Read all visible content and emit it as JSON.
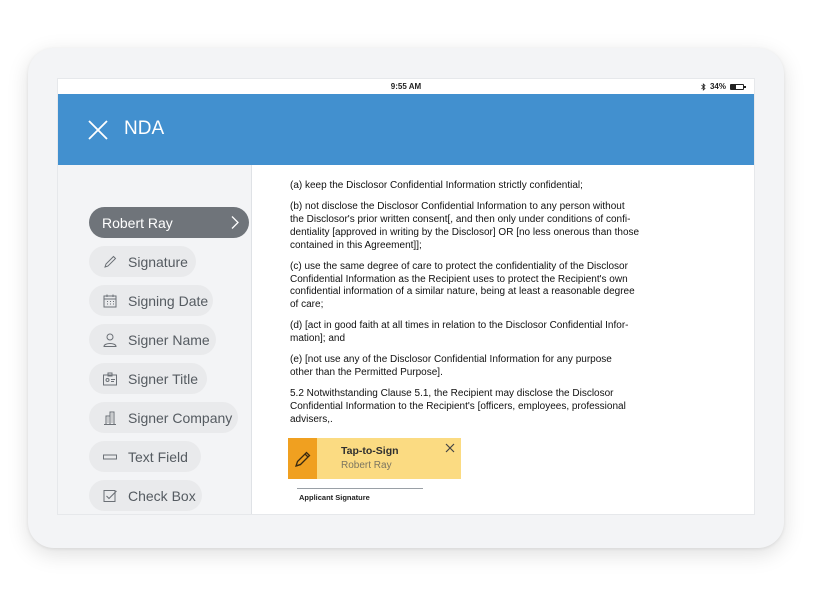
{
  "status_bar": {
    "time": "9:55 AM",
    "battery_percent": "34%",
    "icons": [
      "bluetooth-icon",
      "battery-icon"
    ]
  },
  "app_bar": {
    "title": "NDA",
    "close_icon": "close-icon"
  },
  "sidebar": {
    "signer": {
      "label": "Robert Ray",
      "icon": "chevron-right-icon"
    },
    "fields": [
      {
        "label": "Signature",
        "icon": "pencil-icon"
      },
      {
        "label": "Signing Date",
        "icon": "calendar-icon"
      },
      {
        "label": "Signer Name",
        "icon": "person-icon"
      },
      {
        "label": "Signer Title",
        "icon": "id-badge-icon"
      },
      {
        "label": "Signer Company",
        "icon": "building-icon"
      },
      {
        "label": "Text Field",
        "icon": "text-field-icon"
      },
      {
        "label": "Check Box",
        "icon": "checkbox-icon"
      }
    ]
  },
  "document": {
    "paragraphs": [
      {
        "lines": [
          "(a)  keep the Disclosor Confidential Information strictly confidential;"
        ]
      },
      {
        "lines": [
          "(b)  not disclose the Disclosor Confidential Information to any person without",
          "the Disclosor's prior written consent[, and then only under conditions of confi-",
          "dentiality [approved in writing by the Disclosor] OR [no less onerous than those",
          "contained in this Agreement]];"
        ]
      },
      {
        "lines": [
          "(c)  use the same degree of care to protect the confidentiality of the Disclosor",
          "Confidential Information as the Recipient uses to protect the Recipient's own",
          "confidential information of a similar nature, being at least a reasonable degree",
          "of care;"
        ]
      },
      {
        "lines": [
          "(d)  [act in good faith at all times in relation to the Disclosor Confidential Infor-",
          "mation]; and"
        ]
      },
      {
        "lines": [
          "(e)  [not use any of the Disclosor Confidential Information for any purpose",
          "other than the Permitted Purpose]."
        ]
      },
      {
        "lines": [
          "5.2  Notwithstanding Clause 5.1, the Recipient may disclose the Disclosor",
          "Confidential Information to the Recipient's [officers, employees, professional",
          "advisers,."
        ]
      }
    ],
    "sign_tag": {
      "title": "Tap-to-Sign",
      "signer": "Robert Ray",
      "icon": "pen-icon",
      "close_icon": "close-icon",
      "color": "#fbdb82",
      "accent": "#f0a020"
    },
    "signature_caption": "Applicant Signature"
  },
  "colors": {
    "app_bar": "#4290cf",
    "active_pill": "#6f747a",
    "pill": "#e9eaec"
  }
}
